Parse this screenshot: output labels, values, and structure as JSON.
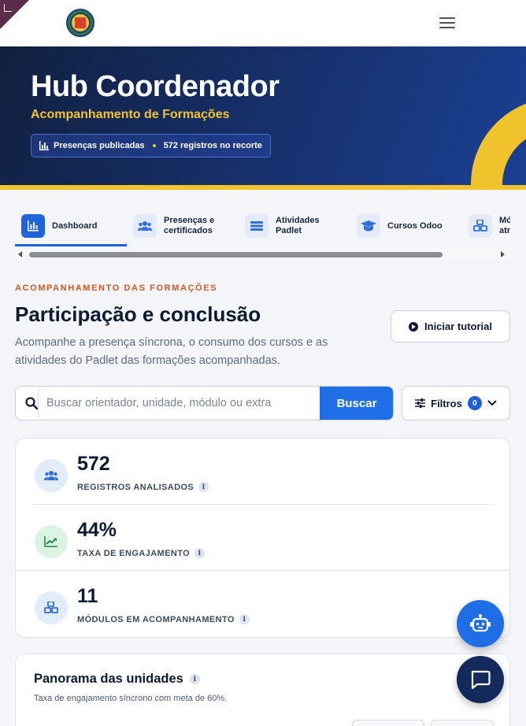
{
  "header": {
    "menu_icon": "hamburger-icon",
    "logo_icon": "institution-seal-logo"
  },
  "hero": {
    "title": "Hub Coordenador",
    "subtitle": "Acompanhamento de Formações",
    "pill": {
      "left": "Presenças publicadas",
      "right": "572 registros no recorte",
      "icon": "bar-chart-icon"
    },
    "colors": {
      "accent": "#f0c22b",
      "background": "#16306a"
    }
  },
  "tabs": [
    {
      "label": "Dashboard",
      "icon": "bar-chart-icon",
      "active": true
    },
    {
      "label": "Presenças e certificados",
      "icon": "users-icon",
      "active": false
    },
    {
      "label": "Atividades Padlet",
      "icon": "list-icon",
      "active": false
    },
    {
      "label": "Cursos Odoo",
      "icon": "graduation-cap-icon",
      "active": false
    },
    {
      "label": "Mó atr",
      "icon": "cubes-icon",
      "active": false
    }
  ],
  "section": {
    "eyebrow": "ACOMPANHAMENTO DAS FORMAÇÕES",
    "title": "Participação e conclusão",
    "description": "Acompanhe a presença síncrona, o consumo dos cursos e as atividades do Padlet das formações acompanhadas.",
    "tutorial_label": "Iniciar tutorial"
  },
  "search": {
    "placeholder": "Buscar orientador, unidade, módulo ou extra",
    "value": "",
    "button_label": "Buscar"
  },
  "filters": {
    "label": "Filtros",
    "count": "0"
  },
  "stats": [
    {
      "value": "572",
      "label": "REGISTROS ANALISADOS",
      "icon": "users-icon",
      "color": "#1f5ed6"
    },
    {
      "value": "44%",
      "label": "TAXA DE ENGAJAMENTO",
      "icon": "trend-up-icon",
      "color": "#1f8a4a"
    },
    {
      "value": "11",
      "label": "MÓDULOS EM ACOMPANHAMENTO",
      "icon": "cubes-icon",
      "color": "#1f5ed6"
    }
  ],
  "panel": {
    "title": "Panorama das unidades",
    "description": "Taxa de engajamento síncrono com meta de 60%."
  },
  "fabs": {
    "assistant_icon": "robot-icon",
    "chat_icon": "chat-bubble-icon"
  }
}
